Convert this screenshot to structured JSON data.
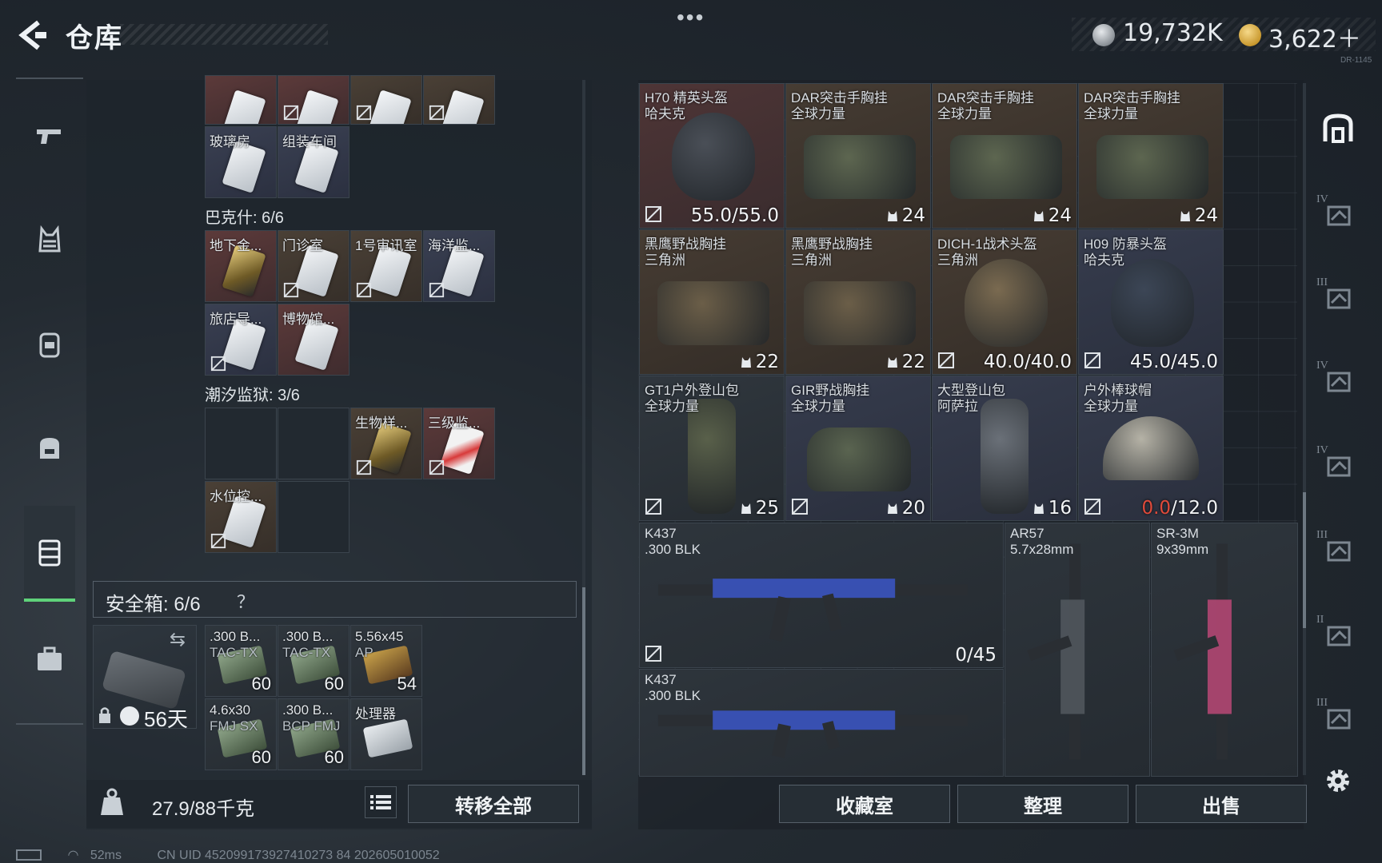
{
  "header": {
    "title": "仓库",
    "menu_dots": "•••",
    "currency_silver": "19,732K",
    "currency_gold": "3,622＋",
    "small_code": "DR-1145"
  },
  "left_nav": {
    "items": [
      "weapons-icon",
      "vest-icon",
      "backpack-icon",
      "bag-icon",
      "warehouse-icon",
      "briefcase-icon"
    ],
    "active": "warehouse-icon"
  },
  "top_row": [
    {
      "label": "",
      "bg": "red"
    },
    {
      "label": "",
      "bg": "red"
    },
    {
      "label": "",
      "bg": "brown"
    },
    {
      "label": "",
      "bg": "brown"
    }
  ],
  "row_glass": [
    {
      "label": "玻璃房",
      "bg": "blue"
    },
    {
      "label": "组装车间",
      "bg": "blue"
    }
  ],
  "bakesh": {
    "title": "巴克什: 6/6",
    "items": [
      {
        "label": "地下金...",
        "bg": "red",
        "card": "gold"
      },
      {
        "label": "门诊室",
        "bg": "brown",
        "card": "white"
      },
      {
        "label": "1号审讯室",
        "bg": "brown",
        "card": "white"
      },
      {
        "label": "海洋监...",
        "bg": "blue",
        "card": "white"
      },
      {
        "label": "旅店导...",
        "bg": "blue",
        "card": "white"
      },
      {
        "label": "博物馆...",
        "bg": "red",
        "card": "white"
      }
    ]
  },
  "tide": {
    "title": "潮汐监狱: 3/6",
    "items": [
      {
        "label": "生物样...",
        "bg": "brown",
        "card": "gold"
      },
      {
        "label": "三级监...",
        "bg": "red",
        "card": "red"
      },
      {
        "label": "水位控...",
        "bg": "brown",
        "card": "white"
      }
    ]
  },
  "safe_box": {
    "label": "安全箱:  6/6",
    "help": "？",
    "days": "56天",
    "swap": "⇆",
    "items": [
      {
        "l1": ".300 B...",
        "l2": "TAC-TX",
        "qty": "60"
      },
      {
        "l1": ".300 B...",
        "l2": "TAC-TX",
        "qty": "60"
      },
      {
        "l1": "5.56x45",
        "l2": "AP",
        "qty": "54"
      },
      {
        "l1": "4.6x30",
        "l2": "FMJ SX",
        "qty": "60"
      },
      {
        "l1": ".300 B...",
        "l2": "BCP FMJ",
        "qty": "60"
      },
      {
        "l1": "处理器",
        "l2": "",
        "qty": ""
      }
    ]
  },
  "bottom_left": {
    "weight": "27.9/88千克",
    "transfer_label": "转移全部"
  },
  "grid_items": [
    {
      "n1": "H70 精英头盔",
      "n2": "哈夫克",
      "stat": "55.0/55.0",
      "type": "helmet",
      "bg": "red",
      "color": "#4a4f57",
      "lock": true,
      "durability": true
    },
    {
      "n1": "DAR突击手胸挂",
      "n2": "全球力量",
      "stat": "24",
      "type": "vest",
      "bg": "brown",
      "color": "#5d6650",
      "lock": false
    },
    {
      "n1": "DAR突击手胸挂",
      "n2": "全球力量",
      "stat": "24",
      "type": "vest",
      "bg": "brown",
      "color": "#5d6650",
      "lock": false
    },
    {
      "n1": "DAR突击手胸挂",
      "n2": "全球力量",
      "stat": "24",
      "type": "vest",
      "bg": "brown",
      "color": "#5d6650",
      "lock": false
    },
    {
      "n1": "黑鹰野战胸挂",
      "n2": "三角洲",
      "stat": "22",
      "type": "vest",
      "bg": "brown",
      "color": "#6b5e48",
      "lock": false
    },
    {
      "n1": "黑鹰野战胸挂",
      "n2": "三角洲",
      "stat": "22",
      "type": "vest",
      "bg": "brown",
      "color": "#6b5e48",
      "lock": false
    },
    {
      "n1": "DICH-1战术头盔",
      "n2": "三角洲",
      "stat": "40.0/40.0",
      "type": "helmet",
      "bg": "brown",
      "color": "#7a6a50",
      "lock": true,
      "durability": true
    },
    {
      "n1": "H09 防暴头盔",
      "n2": "哈夫克",
      "stat": "45.0/45.0",
      "type": "helmet",
      "bg": "blue",
      "color": "#3c4656",
      "lock": true,
      "durability": true
    },
    {
      "n1": "GT1户外登山包",
      "n2": "全球力量",
      "stat": "25",
      "type": "bag-tall",
      "bg": "gray",
      "color": "#59604a",
      "lock": true
    },
    {
      "n1": "GIR野战胸挂",
      "n2": "全球力量",
      "stat": "20",
      "type": "bag-wide",
      "bg": "blue",
      "color": "#5a6450",
      "lock": true
    },
    {
      "n1": "大型登山包",
      "n2": "阿萨拉",
      "stat": "16",
      "type": "bag-tall",
      "bg": "blue",
      "color": "#6a7078",
      "lock": false
    },
    {
      "n1": "户外棒球帽",
      "n2": "全球力量",
      "stat_bad": "0.0",
      "stat": "/12.0",
      "type": "cap",
      "bg": "blue",
      "color": "#b5b2a6",
      "lock": true,
      "durability": true
    }
  ],
  "weapons": [
    {
      "n1": "K437",
      "n2": ".300 BLK",
      "stat": "0/45",
      "lock": true
    },
    {
      "n1": "AR57",
      "n2": "5.7x28mm",
      "stat": "",
      "lock": false
    },
    {
      "n1": "SR-3M",
      "n2": "9x39mm",
      "stat": "",
      "lock": false
    },
    {
      "n1": "K437",
      "n2": ".300 BLK",
      "stat": "",
      "lock": false
    }
  ],
  "bottom_right": {
    "collection_label": "收藏室",
    "organize_label": "整理",
    "sell_label": "出售"
  },
  "right_nav": {
    "tiers": [
      "",
      "IV",
      "III",
      "IV",
      "IV",
      "III",
      "II",
      "III"
    ]
  },
  "status": {
    "ping": "52ms",
    "uid": "CN UID 452099173927410273 84 202605010052"
  }
}
